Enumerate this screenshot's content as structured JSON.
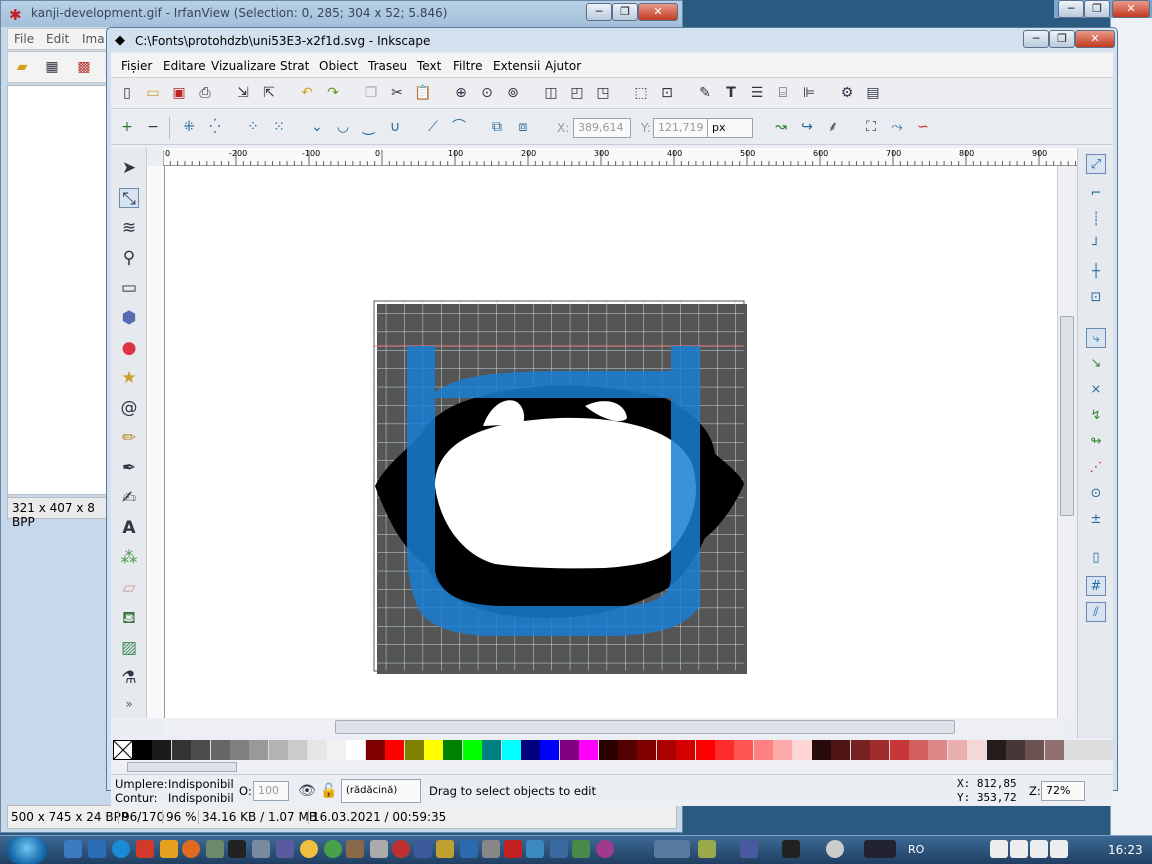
{
  "irfanview": {
    "title": "kanji-development.gif - IrfanView (Selection: 0, 285; 304 x 52; 5.846)",
    "menu": [
      "File",
      "Edit",
      "Ima"
    ],
    "status_left": "321 x 407 x 8 BPP",
    "statusbar": [
      "500 x 745 x 24 BPP",
      "96/170",
      "96 %",
      "34.16 KB / 1.07 MB",
      "16.03.2021 / 00:59:35"
    ]
  },
  "inkscape": {
    "title": "C:\\Fonts\\protohdzb\\uni53E3-x2f1d.svg - Inkscape",
    "menu": [
      "Fișier",
      "Editare",
      "Vizualizare",
      "Strat",
      "Obiect",
      "Traseu",
      "Text",
      "Filtre",
      "Extensii",
      "Ajutor"
    ],
    "x_label": "X:",
    "x_value": "389,614",
    "y_label": "Y:",
    "y_value": "121,719",
    "unit": "px",
    "ruler_ticks": [
      "0",
      "-200",
      "-100",
      "0",
      "100",
      "200",
      "300",
      "400",
      "500",
      "600",
      "700",
      "800",
      "900"
    ],
    "status": {
      "fill_label": "Umplere:",
      "fill_value": "Indisponibil",
      "stroke_label": "Contur:",
      "stroke_value": "Indisponibil",
      "opacity_label": "O:",
      "opacity_value": "100",
      "layer": "(rădăcină)",
      "message": "Drag to select objects to edit",
      "cursor_x": "X:   812,85",
      "cursor_y": "Y:   353,72",
      "zoom_label": "Z:",
      "zoom": "72%"
    }
  },
  "palette": [
    "#000000",
    "#1a1a1a",
    "#333333",
    "#4d4d4d",
    "#666666",
    "#808080",
    "#999999",
    "#b3b3b3",
    "#cccccc",
    "#e6e6e6",
    "#f2f2f2",
    "#ffffff",
    "#800000",
    "#ff0000",
    "#808000",
    "#ffff00",
    "#008000",
    "#00ff00",
    "#008080",
    "#00ffff",
    "#000080",
    "#0000ff",
    "#800080",
    "#ff00ff",
    "#2b0000",
    "#550000",
    "#800000",
    "#aa0000",
    "#d40000",
    "#ff0000",
    "#ff2a2a",
    "#ff5555",
    "#ff8080",
    "#ffaaaa",
    "#ffd5d5",
    "#280b0b",
    "#501616",
    "#782121",
    "#a02c2c",
    "#c83737",
    "#d35f5f",
    "#de8787",
    "#e9afaf",
    "#f4d7d7",
    "#241c1c",
    "#483737",
    "#6c5353",
    "#916f6f"
  ],
  "taskbar": {
    "lang": "RO",
    "clock": "16:23"
  }
}
